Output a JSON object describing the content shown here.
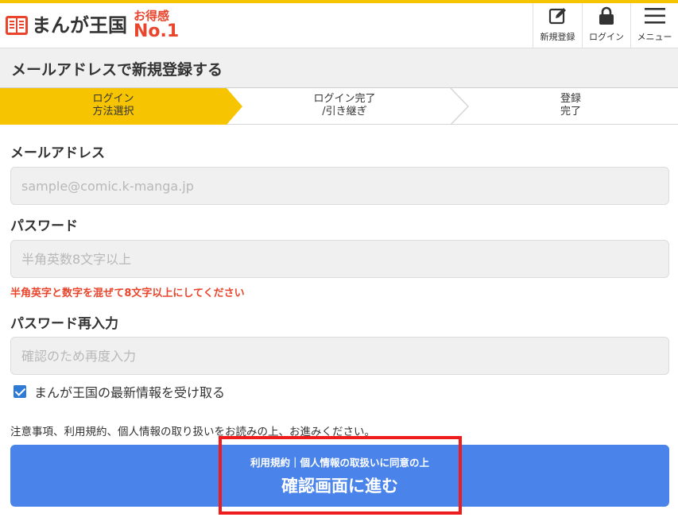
{
  "header": {
    "logo_text": "まんが王国",
    "badge_top": "お得感",
    "badge_bottom": "No.1",
    "nav": [
      {
        "label": "新規登録",
        "icon": "edit-icon"
      },
      {
        "label": "ログイン",
        "icon": "lock-icon"
      },
      {
        "label": "メニュー",
        "icon": "hamburger-menu-icon"
      }
    ]
  },
  "page_title": "メールアドレスで新規登録する",
  "steps": [
    {
      "line1": "ログイン",
      "line2": "方法選択",
      "active": true
    },
    {
      "line1": "ログイン完了",
      "line2": "/引き継ぎ",
      "active": false
    },
    {
      "line1": "登録",
      "line2": "完了",
      "active": false
    }
  ],
  "form": {
    "email_label": "メールアドレス",
    "email_placeholder": "sample@comic.k-manga.jp",
    "email_value": "",
    "password_label": "パスワード",
    "password_placeholder": "半角英数8文字以上",
    "password_value": "",
    "password_hint": "半角英字と数字を混ぜて8文字以上にしてください",
    "confirm_label": "パスワード再入力",
    "confirm_placeholder": "確認のため再度入力",
    "confirm_value": "",
    "newsletter_label": "まんが王国の最新情報を受け取る",
    "newsletter_checked": true
  },
  "notice": "注意事項、利用規約、個人情報の取り扱いをお読みの上、お進みください。",
  "submit": {
    "sub_label": "利用規約｜個人情報の取扱いに同意の上",
    "main_label": "確認画面に進む"
  },
  "colors": {
    "accent_yellow": "#f6c400",
    "brand_red": "#e8452c",
    "button_blue": "#4a84ea",
    "highlight_red": "#ee1c1c"
  }
}
